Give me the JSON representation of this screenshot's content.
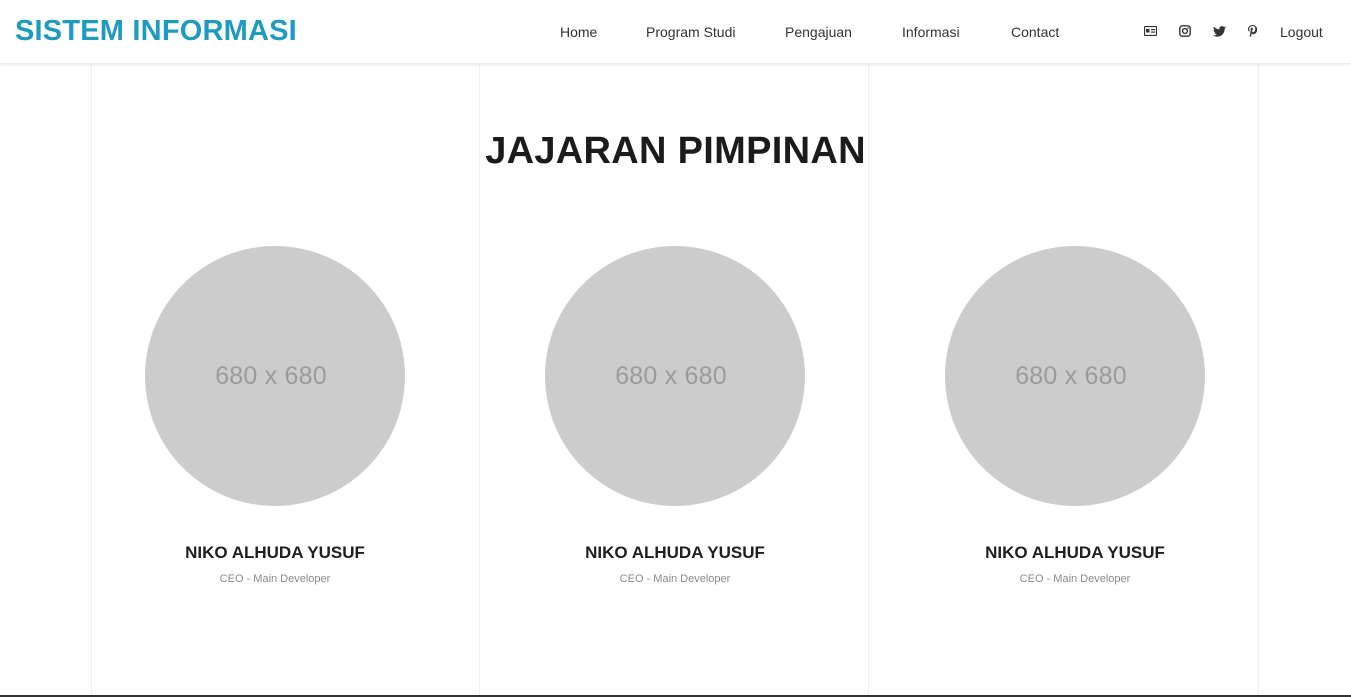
{
  "header": {
    "brand": "SISTEM INFORMASI",
    "nav": [
      "Home",
      "Program Studi",
      "Pengajuan",
      "Informasi",
      "Contact"
    ],
    "social_icons": [
      "id-card-icon",
      "instagram-icon",
      "twitter-icon",
      "pinterest-icon"
    ],
    "logout_label": "Logout"
  },
  "section": {
    "title": "JAJARAN PIMPINAN"
  },
  "members": [
    {
      "placeholder": "680 x 680",
      "name": "NIKO ALHUDA YUSUF",
      "role": "CEO - Main Developer"
    },
    {
      "placeholder": "680 x 680",
      "name": "NIKO ALHUDA YUSUF",
      "role": "CEO - Main Developer"
    },
    {
      "placeholder": "680 x 680",
      "name": "NIKO ALHUDA YUSUF",
      "role": "CEO - Main Developer"
    }
  ],
  "colors": {
    "brand": "#1f9bbf",
    "avatar_placeholder": "#cccccc",
    "text_dark": "#1e1e1e",
    "text_muted": "#8a8a8a"
  }
}
